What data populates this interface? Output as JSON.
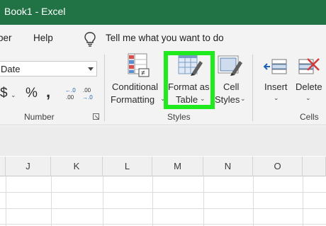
{
  "window": {
    "title": "Book1  -  Excel"
  },
  "ribbon_tabs": [
    {
      "label": "per"
    },
    {
      "label": "Help"
    }
  ],
  "tell_me": {
    "text": "Tell me what you want to do",
    "icon": "lightbulb-icon"
  },
  "number_group": {
    "format_value": "Date",
    "currency_symbol": "$",
    "percent_symbol": "%",
    "comma_symbol": ",",
    "label": "Number"
  },
  "styles_group": {
    "conditional_formatting": {
      "line1": "Conditional",
      "line2": "Formatting"
    },
    "format_as_table": {
      "line1": "Format as",
      "line2": "Table"
    },
    "cell_styles": {
      "line1": "Cell",
      "line2": "Styles"
    },
    "label": "Styles"
  },
  "cells_group": {
    "insert": "Insert",
    "delete": "Delete",
    "label": "Cells"
  },
  "column_headers": [
    "J",
    "K",
    "L",
    "M",
    "N",
    "O"
  ],
  "colors": {
    "title_bar": "#217346",
    "highlight": "#1eea1e",
    "ribbon_bg": "#f3f3f3"
  }
}
